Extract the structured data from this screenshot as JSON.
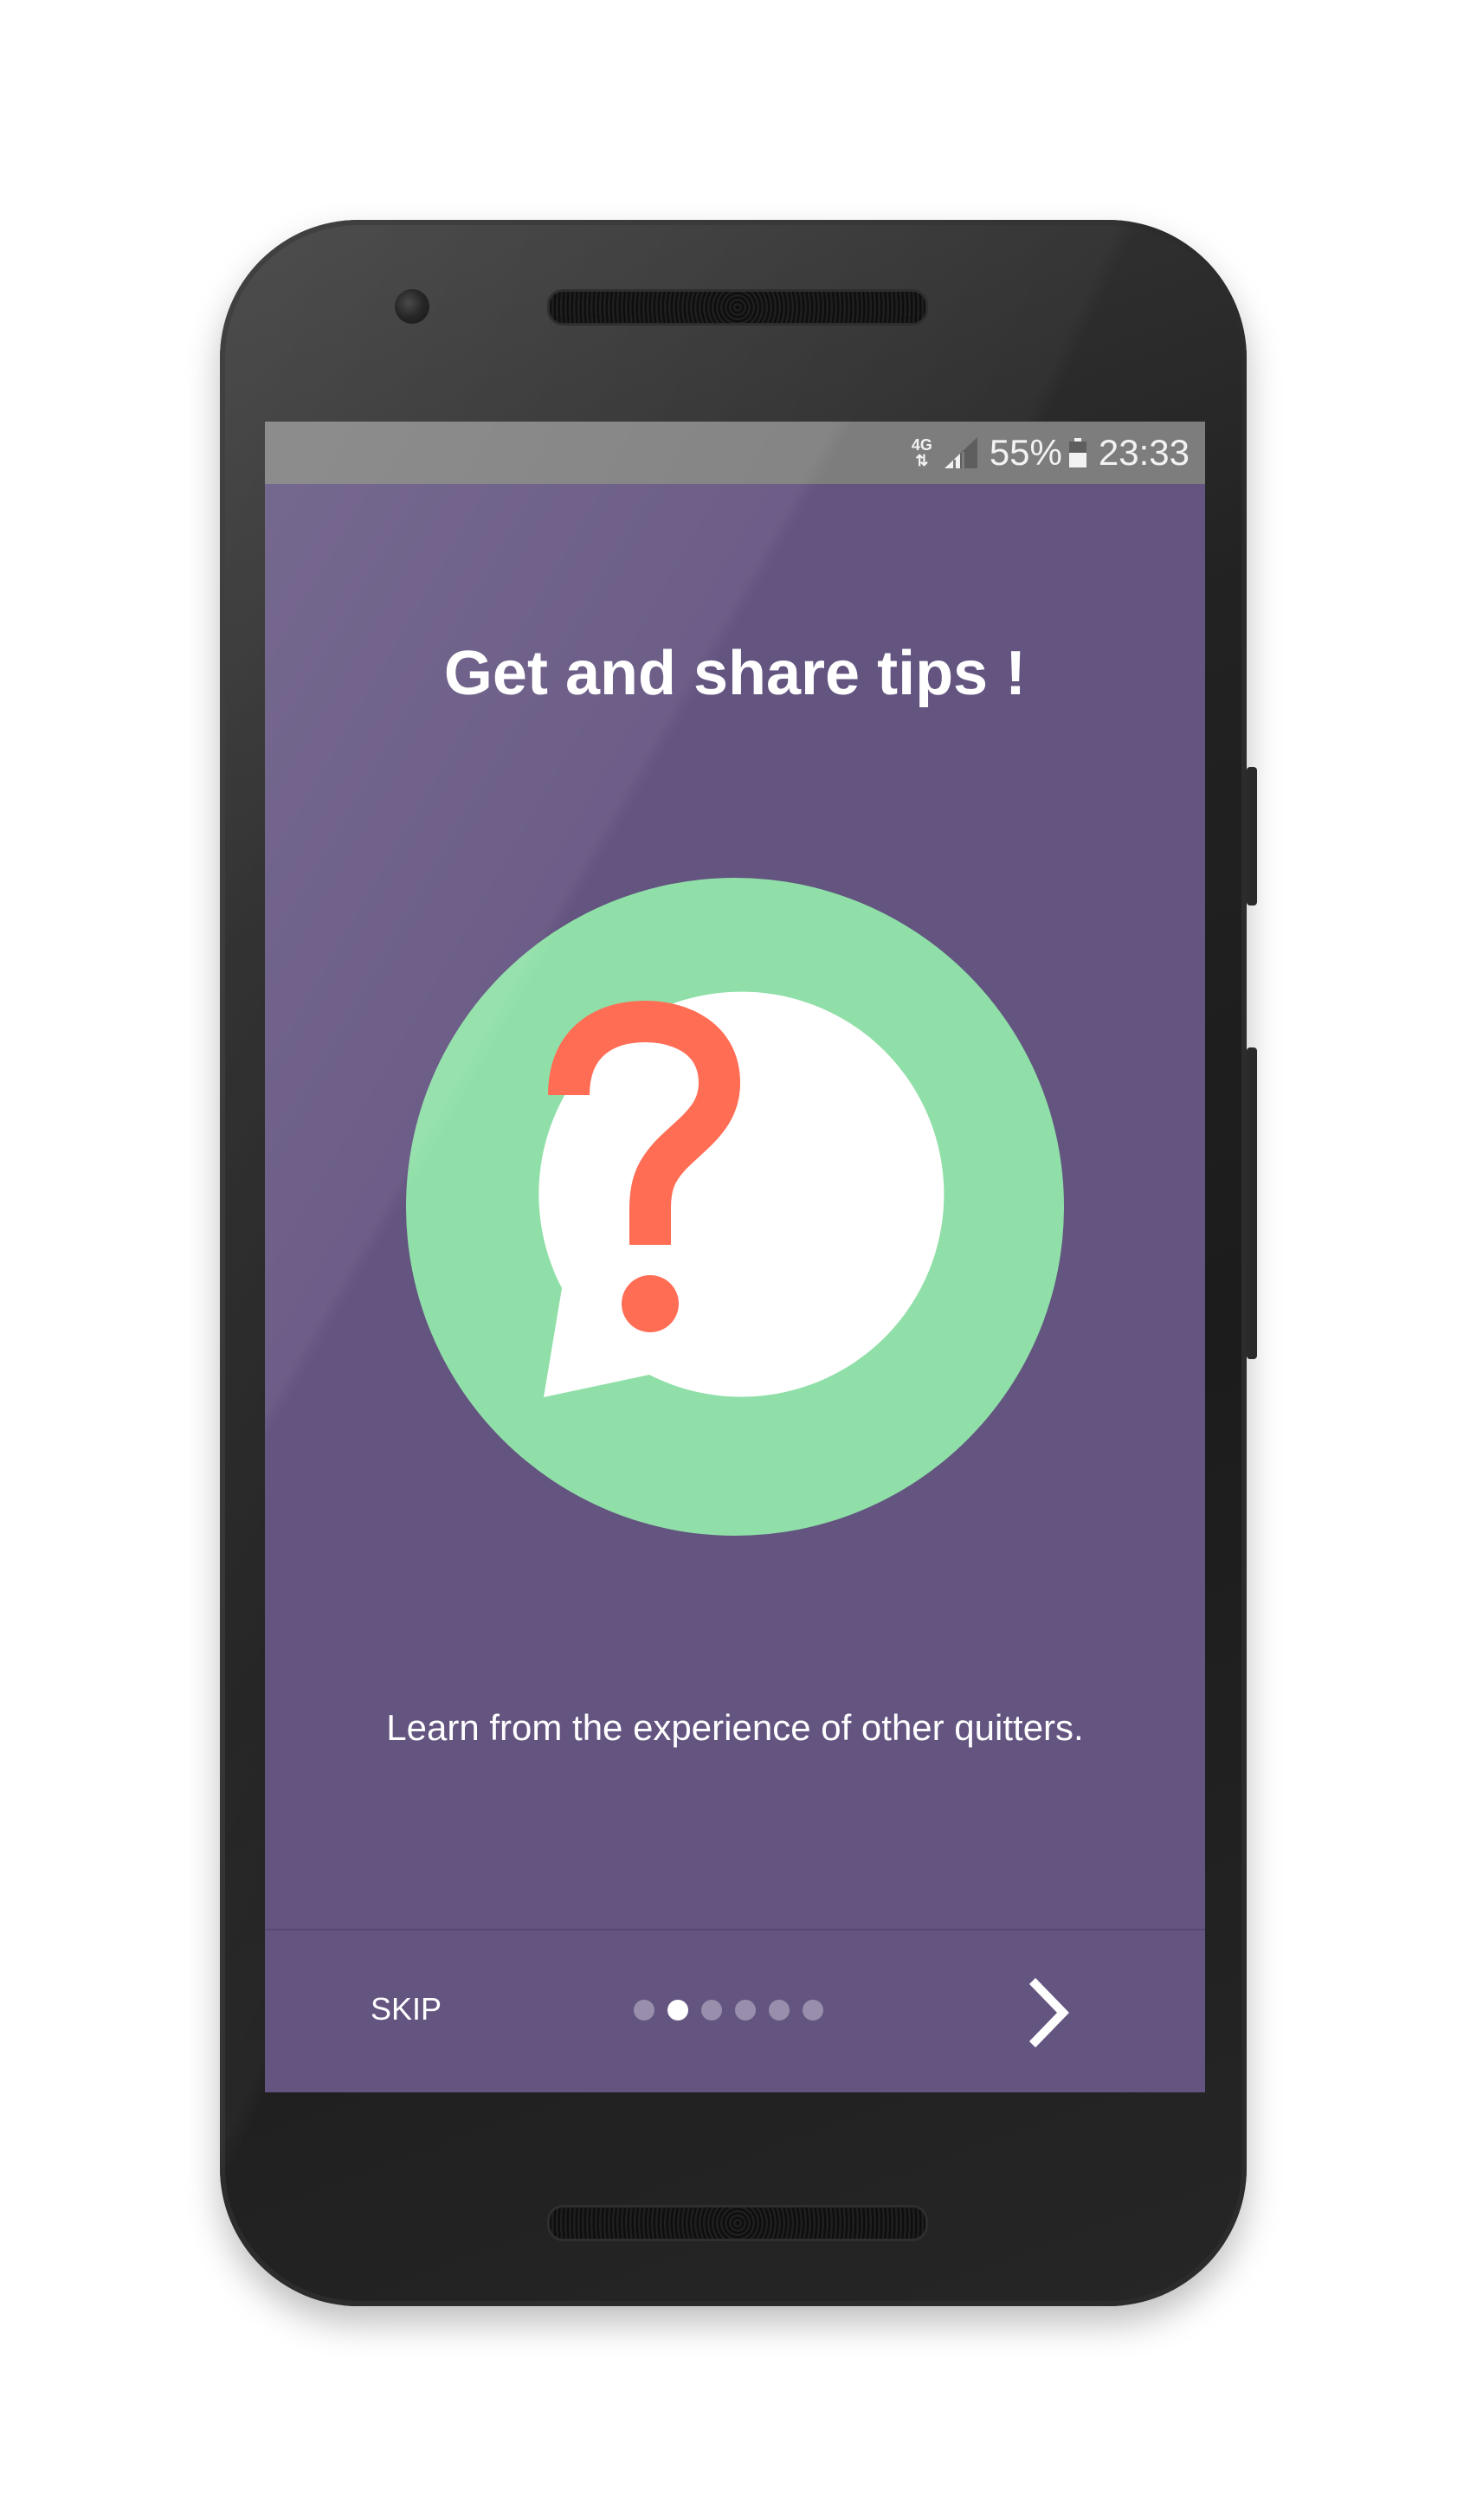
{
  "status_bar": {
    "network": "4G",
    "battery_percent": "55%",
    "time": "23:33",
    "signal_icon": "signal-bars-icon",
    "battery_icon": "battery-icon"
  },
  "onboarding": {
    "title": "Get and share tips !",
    "description": "Learn from the experience of other quitters.",
    "illustration_icon": "question-speech-bubble-icon"
  },
  "navigation": {
    "skip_label": "SKIP",
    "page_count": 6,
    "current_page": 2,
    "next_icon": "chevron-right-icon"
  },
  "colors": {
    "background": "#635480",
    "circle": "#90DFA8",
    "bubble": "#FFFFFF",
    "question_mark": "#FF6D55",
    "status_bar": "#7D7D7D"
  }
}
